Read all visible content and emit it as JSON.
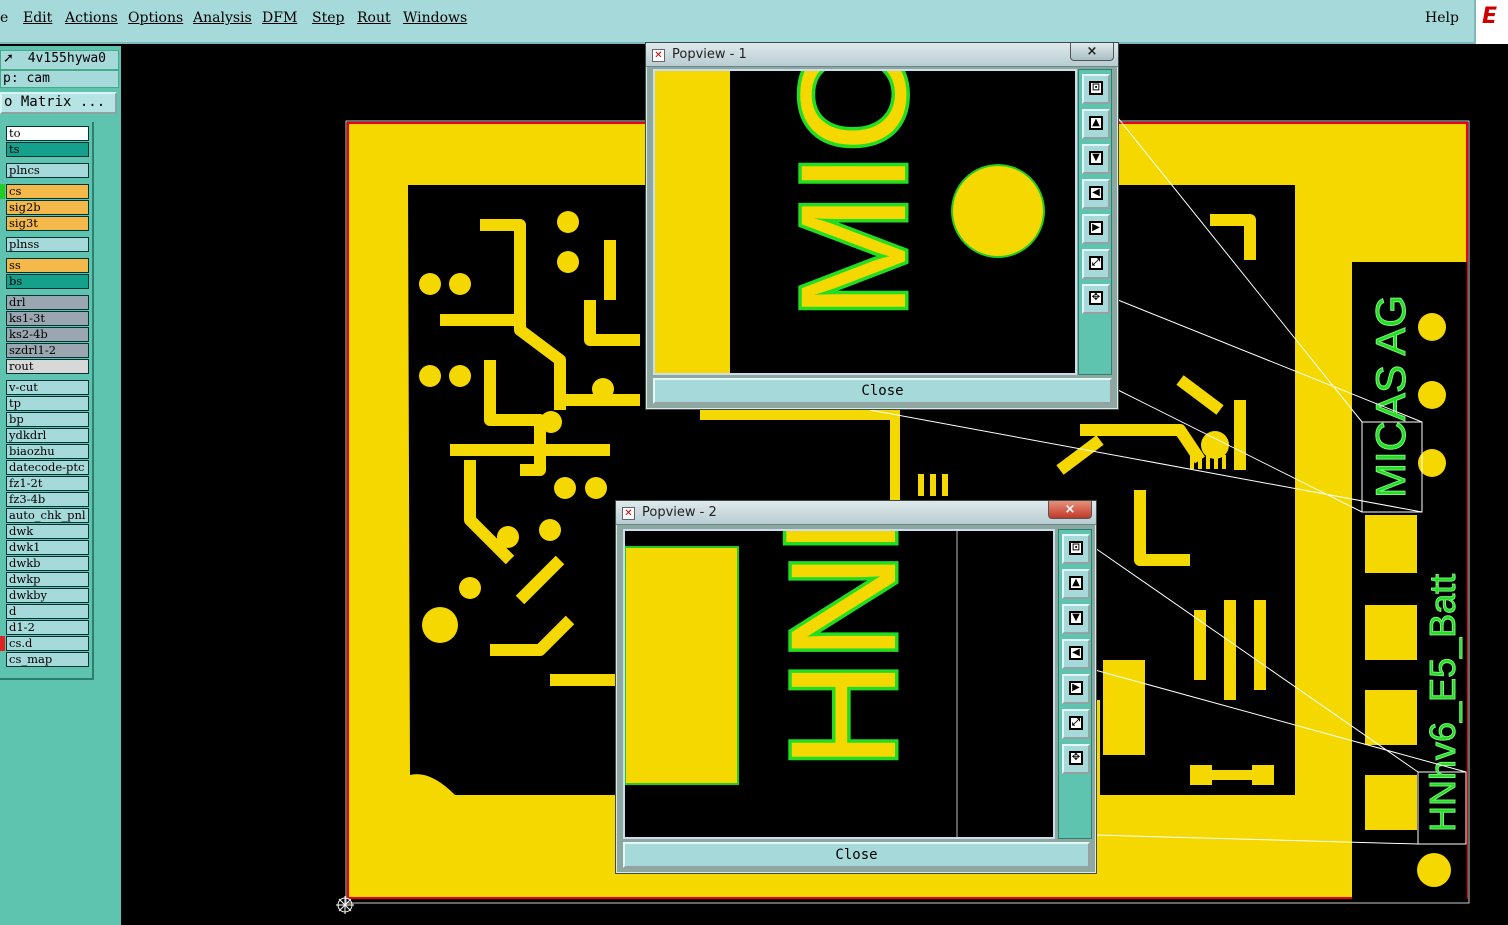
{
  "menubar": {
    "items": [
      "e",
      "Edit",
      "Actions",
      "Options",
      "Analysis",
      "DFM",
      "Step",
      "Rout",
      "Windows"
    ],
    "help": "Help",
    "logo_text": "E"
  },
  "left_panel": {
    "job": "4v155hywa0",
    "step": "p: cam",
    "matrix_button": "o Matrix ..."
  },
  "layers": [
    {
      "name": "to",
      "color": "#ffffff"
    },
    {
      "name": "ts",
      "color": "#14a08a"
    },
    {
      "name": "plncs",
      "color": "#a6d9d9"
    },
    {
      "name": "cs",
      "color": "#f5b84a",
      "mark": "#22cc22"
    },
    {
      "name": "sig2b",
      "color": "#f5b84a"
    },
    {
      "name": "sig3t",
      "color": "#f5b84a"
    },
    {
      "name": "plnss",
      "color": "#a6d9d9"
    },
    {
      "name": "ss",
      "color": "#f5b84a"
    },
    {
      "name": "bs",
      "color": "#14a08a"
    },
    {
      "name": "drl",
      "color": "#9aa6b0"
    },
    {
      "name": "ks1-3t",
      "color": "#9aa6b0"
    },
    {
      "name": "ks2-4b",
      "color": "#9aa6b0"
    },
    {
      "name": "szdrl1-2",
      "color": "#9aa6b0"
    },
    {
      "name": "rout",
      "color": "#d8d8d8"
    },
    {
      "name": "v-cut",
      "color": "#a6d9d9"
    },
    {
      "name": "tp",
      "color": "#a6d9d9"
    },
    {
      "name": "bp",
      "color": "#a6d9d9"
    },
    {
      "name": "ydkdrl",
      "color": "#a6d9d9"
    },
    {
      "name": "biaozhu",
      "color": "#a6d9d9"
    },
    {
      "name": "datecode-ptc",
      "color": "#a6d9d9"
    },
    {
      "name": "fz1-2t",
      "color": "#a6d9d9"
    },
    {
      "name": "fz3-4b",
      "color": "#a6d9d9"
    },
    {
      "name": "auto_chk_pnl",
      "color": "#a6d9d9"
    },
    {
      "name": "dwk",
      "color": "#a6d9d9"
    },
    {
      "name": "dwk1",
      "color": "#a6d9d9"
    },
    {
      "name": "dwkb",
      "color": "#a6d9d9"
    },
    {
      "name": "dwkp",
      "color": "#a6d9d9"
    },
    {
      "name": "dwkby",
      "color": "#a6d9d9"
    },
    {
      "name": "d",
      "color": "#a6d9d9"
    },
    {
      "name": "d1-2",
      "color": "#a6d9d9"
    },
    {
      "name": "cs.d",
      "color": "#a6d9d9",
      "mark": "#dd2222"
    },
    {
      "name": "cs_map",
      "color": "#a6d9d9"
    }
  ],
  "board": {
    "text_micas": "MICAS AG",
    "text_hnhv": "HNhv6_E5_Batt",
    "copper_color": "#f5d800",
    "outline_color": "#22dd22"
  },
  "popview1": {
    "title": "Popview - 1",
    "close_x": "×",
    "close_button": "Close",
    "zoom_text": "MIC/"
  },
  "popview2": {
    "title": "Popview - 2",
    "close_x": "×",
    "close_button": "Close",
    "zoom_text": "HNhv"
  },
  "popview_tools": [
    "zoom-home",
    "zoom-up",
    "zoom-down",
    "pan-left",
    "pan-right",
    "fit-all",
    "center"
  ]
}
